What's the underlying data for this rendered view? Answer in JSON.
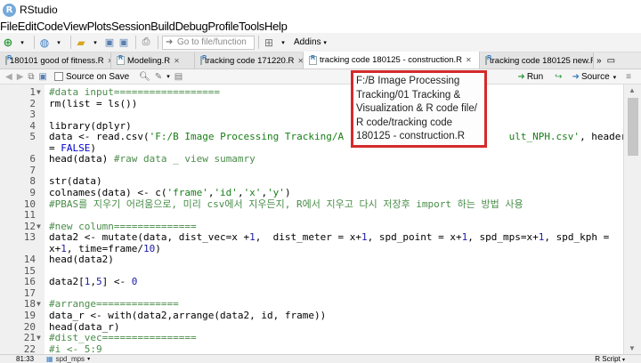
{
  "window": {
    "title": "RStudio"
  },
  "menu": [
    "File",
    "Edit",
    "Code",
    "View",
    "Plots",
    "Session",
    "Build",
    "Debug",
    "Profile",
    "Tools",
    "Help"
  ],
  "toolbar": {
    "goto_placeholder": "Go to file/function",
    "addins_label": "Addins"
  },
  "tabs": [
    {
      "label": "180101 good of fitness.R",
      "active": false
    },
    {
      "label": "Modeling.R",
      "active": false
    },
    {
      "label": "tracking code 171220.R",
      "active": false
    },
    {
      "label": "tracking code 180125 - construction.R",
      "active": true
    },
    {
      "label": "tracking code 180125 new.R",
      "active": false
    }
  ],
  "editor_toolbar": {
    "source_on_save": "Source on Save",
    "run": "Run",
    "source": "Source"
  },
  "tooltip_lines": [
    "F:/B Image Processing",
    "Tracking/01 Tracking &",
    "Visualization & R code file/",
    "R code/tracking code",
    "180125 - construction.R"
  ],
  "code_lines": [
    {
      "n": "1",
      "fold": "▼",
      "segs": [
        {
          "c": "cm",
          "t": "#data input=================="
        }
      ]
    },
    {
      "n": "2",
      "fold": "",
      "segs": [
        {
          "c": "",
          "t": "rm(list = ls())"
        }
      ]
    },
    {
      "n": "3",
      "fold": "",
      "segs": []
    },
    {
      "n": "4",
      "fold": "",
      "segs": [
        {
          "c": "",
          "t": "library(dplyr)"
        }
      ]
    },
    {
      "n": "5",
      "fold": "",
      "segs": [
        {
          "c": "",
          "t": "data <- read.csv("
        },
        {
          "c": "str",
          "t": "'F:/B Image Processing Tracking/A"
        },
        {
          "c": "",
          "t": "                            "
        },
        {
          "c": "str",
          "t": "ult_NPH.csv'"
        },
        {
          "c": "",
          "t": ", header"
        }
      ]
    },
    {
      "n": "",
      "fold": "",
      "segs": [
        {
          "c": "",
          "t": "= "
        },
        {
          "c": "kw",
          "t": "FALSE"
        },
        {
          "c": "",
          "t": ")"
        }
      ]
    },
    {
      "n": "6",
      "fold": "",
      "segs": [
        {
          "c": "",
          "t": "head(data) "
        },
        {
          "c": "cm",
          "t": "#raw data _ view sumamry"
        }
      ]
    },
    {
      "n": "7",
      "fold": "",
      "segs": []
    },
    {
      "n": "8",
      "fold": "",
      "segs": [
        {
          "c": "",
          "t": "str(data)"
        }
      ]
    },
    {
      "n": "9",
      "fold": "",
      "segs": [
        {
          "c": "",
          "t": "colnames(data) <- c("
        },
        {
          "c": "str",
          "t": "'frame'"
        },
        {
          "c": "",
          "t": ","
        },
        {
          "c": "str",
          "t": "'id'"
        },
        {
          "c": "",
          "t": ","
        },
        {
          "c": "str",
          "t": "'x'"
        },
        {
          "c": "",
          "t": ","
        },
        {
          "c": "str",
          "t": "'y'"
        },
        {
          "c": "",
          "t": ")"
        }
      ]
    },
    {
      "n": "10",
      "fold": "",
      "segs": [
        {
          "c": "cm",
          "t": "#PBAS를 지우기 어려움으로, 미리 csv에서 지우든지, R에서 지우고 다시 저장후 import 하는 방법 사용"
        }
      ]
    },
    {
      "n": "11",
      "fold": "",
      "segs": []
    },
    {
      "n": "12",
      "fold": "▼",
      "segs": [
        {
          "c": "cm",
          "t": "#new column=============="
        }
      ]
    },
    {
      "n": "13",
      "fold": "",
      "segs": [
        {
          "c": "",
          "t": "data2 <- mutate(data, dist_vec=x +"
        },
        {
          "c": "num",
          "t": "1"
        },
        {
          "c": "",
          "t": ",  dist_meter = x+"
        },
        {
          "c": "num",
          "t": "1"
        },
        {
          "c": "",
          "t": ", spd_point = x+"
        },
        {
          "c": "num",
          "t": "1"
        },
        {
          "c": "",
          "t": ", spd_mps=x+"
        },
        {
          "c": "num",
          "t": "1"
        },
        {
          "c": "",
          "t": ", spd_kph ="
        }
      ]
    },
    {
      "n": "",
      "fold": "",
      "segs": [
        {
          "c": "",
          "t": "x+"
        },
        {
          "c": "num",
          "t": "1"
        },
        {
          "c": "",
          "t": ", time=frame/"
        },
        {
          "c": "num",
          "t": "10"
        },
        {
          "c": "",
          "t": ")"
        }
      ]
    },
    {
      "n": "14",
      "fold": "",
      "segs": [
        {
          "c": "",
          "t": "head(data2)"
        }
      ]
    },
    {
      "n": "15",
      "fold": "",
      "segs": []
    },
    {
      "n": "16",
      "fold": "",
      "segs": [
        {
          "c": "",
          "t": "data2["
        },
        {
          "c": "num",
          "t": "1"
        },
        {
          "c": "",
          "t": ","
        },
        {
          "c": "num",
          "t": "5"
        },
        {
          "c": "",
          "t": "] <- "
        },
        {
          "c": "num",
          "t": "0"
        }
      ]
    },
    {
      "n": "17",
      "fold": "",
      "segs": []
    },
    {
      "n": "18",
      "fold": "▼",
      "segs": [
        {
          "c": "cm",
          "t": "#arrange=============="
        }
      ]
    },
    {
      "n": "19",
      "fold": "",
      "segs": [
        {
          "c": "",
          "t": "data_r <- with(data2,arrange(data2, id, frame))"
        }
      ]
    },
    {
      "n": "20",
      "fold": "",
      "segs": [
        {
          "c": "",
          "t": "head(data_r)"
        }
      ]
    },
    {
      "n": "21",
      "fold": "▼",
      "segs": [
        {
          "c": "cm",
          "t": "#dist_vec================"
        }
      ]
    },
    {
      "n": "22",
      "fold": "",
      "segs": [
        {
          "c": "cm",
          "t": "#i <- 5:9"
        }
      ]
    }
  ],
  "status": {
    "position": "81:33",
    "function": "spd_mps",
    "file_type": "R Script"
  }
}
